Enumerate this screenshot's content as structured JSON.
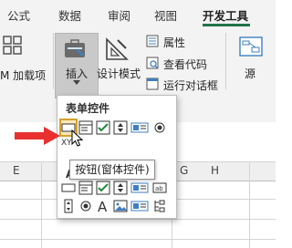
{
  "tabs": [
    "公式",
    "数据",
    "审阅",
    "视图",
    "开发工具"
  ],
  "active_tab": "开发工具",
  "ribbon": {
    "addins_label": "M 加载项",
    "insert_label": "插入",
    "design_mode_label": "设计模式",
    "properties_label": "属性",
    "view_code_label": "查看代码",
    "run_dialog_label": "运行对话框",
    "source_label": "源"
  },
  "dropdown": {
    "form_controls_title": "表单控件",
    "activex_title_partial": "A",
    "tooltip": "按钮(窗体控件)"
  },
  "sheet": {
    "column_headers": [
      "E",
      "F",
      "G",
      "H"
    ],
    "cell_partial": "XY"
  },
  "colors": {
    "accent": "#217346",
    "arrow": "#e8312f",
    "highlight": "#fde8b8"
  },
  "icons": [
    "addins-icon",
    "insert-controls-icon",
    "design-mode-icon",
    "properties-icon",
    "view-code-icon",
    "run-dialog-icon",
    "source-icon",
    "mouse-cursor-icon"
  ]
}
